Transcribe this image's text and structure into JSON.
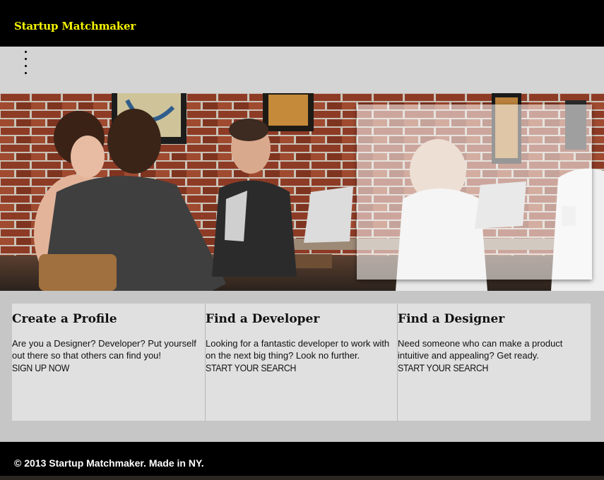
{
  "header": {
    "brand": "Startup Matchmaker",
    "brand_color": "#f4f400"
  },
  "menu": {
    "icon": "vertical-dots-icon"
  },
  "features": [
    {
      "title": "Create a Profile",
      "text": "Are you a Designer? Developer? Put yourself out there so that others can find you!",
      "link": "SIGN UP NOW"
    },
    {
      "title": "Find a Developer",
      "text": "Looking for a fantastic developer to work with on the next big thing? Look no further.",
      "link": "START YOUR SEARCH"
    },
    {
      "title": "Find a Designer",
      "text": "Need someone who can make a product intuitive and appealing? Get ready.",
      "link": "START YOUR SEARCH"
    }
  ],
  "footer": {
    "text": "© 2013 Startup Matchmaker. Made in NY."
  }
}
